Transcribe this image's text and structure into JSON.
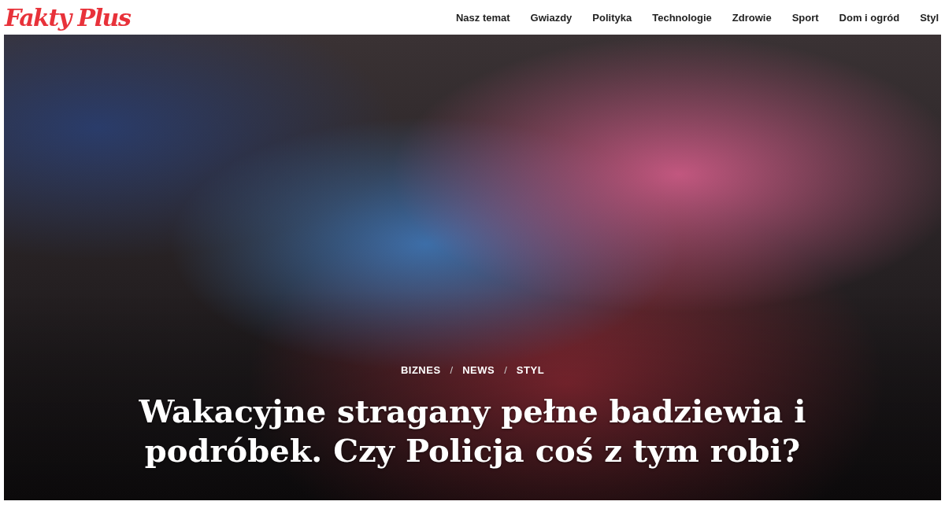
{
  "site": {
    "logo": "Fakty Plus"
  },
  "nav": [
    {
      "label": "Nasz temat"
    },
    {
      "label": "Gwiazdy"
    },
    {
      "label": "Polityka"
    },
    {
      "label": "Technologie"
    },
    {
      "label": "Zdrowie"
    },
    {
      "label": "Sport"
    },
    {
      "label": "Dom i ogród"
    },
    {
      "label": "Styl"
    }
  ],
  "hero": {
    "categories": [
      "BIZNES",
      "NEWS",
      "STYL"
    ],
    "separator": "/",
    "title": "Wakacyjne stragany pełne badziewia i podróbek. Czy Policja coś z tym robi?"
  }
}
